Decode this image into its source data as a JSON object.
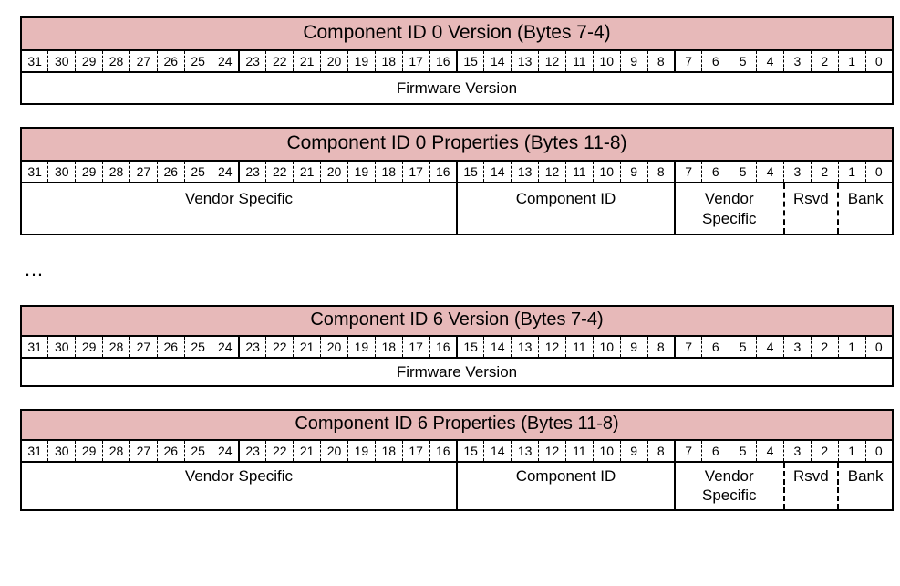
{
  "bits": [
    "31",
    "30",
    "29",
    "28",
    "27",
    "26",
    "25",
    "24",
    "23",
    "22",
    "21",
    "20",
    "19",
    "18",
    "17",
    "16",
    "15",
    "14",
    "13",
    "12",
    "11",
    "10",
    "9",
    "8",
    "7",
    "6",
    "5",
    "4",
    "3",
    "2",
    "1",
    "0"
  ],
  "ellipsis": "…",
  "tables": [
    {
      "title": "Component ID 0 Version (Bytes 7-4)",
      "fields": [
        {
          "span": 32,
          "label": "Firmware Version",
          "sep": ""
        }
      ]
    },
    {
      "title": "Component ID 0 Properties (Bytes 11-8)",
      "fields": [
        {
          "span": 16,
          "label": "Vendor Specific",
          "sep": "solid"
        },
        {
          "span": 8,
          "label": "Component ID",
          "sep": "solid"
        },
        {
          "span": 4,
          "label": "Vendor Specific",
          "sep": "dash"
        },
        {
          "span": 2,
          "label": "Rsvd",
          "sep": "dash"
        },
        {
          "span": 2,
          "label": "Bank",
          "sep": ""
        }
      ]
    },
    {
      "title": "Component ID 6 Version (Bytes 7-4)",
      "fields": [
        {
          "span": 32,
          "label": "Firmware Version",
          "sep": ""
        }
      ]
    },
    {
      "title": "Component ID 6 Properties (Bytes 11-8)",
      "fields": [
        {
          "span": 16,
          "label": "Vendor Specific",
          "sep": "solid"
        },
        {
          "span": 8,
          "label": "Component ID",
          "sep": "solid"
        },
        {
          "span": 4,
          "label": "Vendor Specific",
          "sep": "dash"
        },
        {
          "span": 2,
          "label": "Rsvd",
          "sep": "dash"
        },
        {
          "span": 2,
          "label": "Bank",
          "sep": ""
        }
      ]
    }
  ]
}
